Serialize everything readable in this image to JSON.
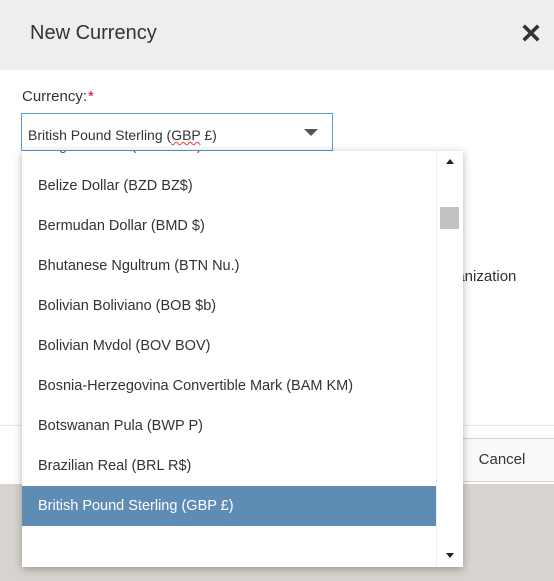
{
  "modal": {
    "title": "New Currency",
    "close_icon": "close-x-icon"
  },
  "form": {
    "currency_label": "Currency:",
    "required_marker": "*",
    "selected_prefix": "British Pound Sterling (",
    "selected_underlined": "GBP",
    "selected_suffix": " £)",
    "caret_icon": "caret-down-icon"
  },
  "behind": {
    "partial_text": "ganization",
    "cancel_label": "Cancel"
  },
  "dropdown": {
    "partial_item": "Belgian Franc (BEF BEF)",
    "items": [
      {
        "label": "Belize Dollar (BZD BZ$)",
        "selected": false
      },
      {
        "label": "Bermudan Dollar (BMD $)",
        "selected": false
      },
      {
        "label": "Bhutanese Ngultrum (BTN Nu.)",
        "selected": false
      },
      {
        "label": "Bolivian Boliviano (BOB $b)",
        "selected": false
      },
      {
        "label": "Bolivian Mvdol (BOV BOV)",
        "selected": false
      },
      {
        "label": "Bosnia-Herzegovina Convertible Mark (BAM KM)",
        "selected": false
      },
      {
        "label": "Botswanan Pula (BWP P)",
        "selected": false
      },
      {
        "label": "Brazilian Real (BRL R$)",
        "selected": false
      },
      {
        "label": "British Pound Sterling (GBP £)",
        "selected": true
      }
    ],
    "scroll_up_icon": "scroll-up-arrow-icon",
    "scroll_down_icon": "scroll-down-arrow-icon"
  },
  "colors": {
    "header_bg": "#eeeeee",
    "select_border": "#5a9bd5",
    "selected_item_bg": "#5f8cb5",
    "required": "#d0021b",
    "backdrop": "#d7d3cf"
  }
}
